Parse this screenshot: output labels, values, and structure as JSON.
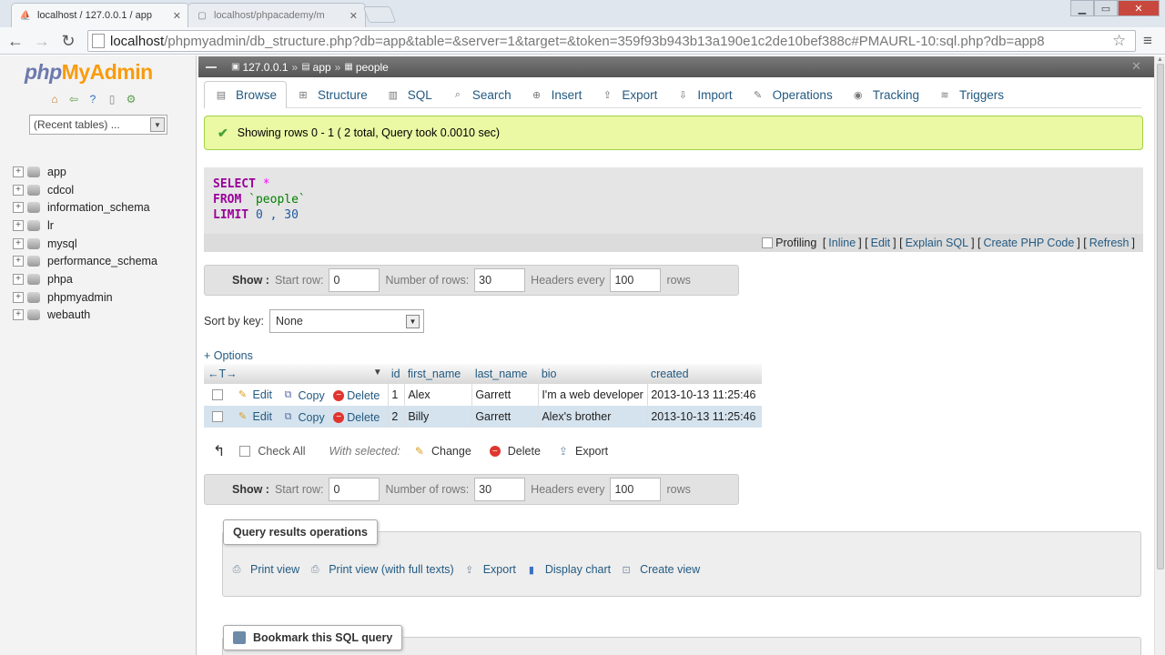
{
  "browser": {
    "tabs": [
      {
        "title": "localhost / 127.0.0.1 / app"
      },
      {
        "title": "localhost/phpacademy/m"
      }
    ],
    "address": {
      "host": "localhost",
      "path": "/phpmyadmin/db_structure.php?db=app&table=&server=1&target=&token=359f93b943b13a190e1c2de10bef388c#PMAURL-10:sql.php?db=app8"
    }
  },
  "sidebar": {
    "logo": {
      "php": "php",
      "my": "My",
      "admin": "Admin"
    },
    "recent_tables": "(Recent tables) ...",
    "databases": [
      "app",
      "cdcol",
      "information_schema",
      "lr",
      "mysql",
      "performance_schema",
      "phpa",
      "phpmyadmin",
      "webauth"
    ]
  },
  "breadcrumb": {
    "server": "127.0.0.1",
    "database": "app",
    "table": "people",
    "sep": "»"
  },
  "tabs": [
    {
      "label": "Browse",
      "icon": "browse-icon"
    },
    {
      "label": "Structure",
      "icon": "structure-icon"
    },
    {
      "label": "SQL",
      "icon": "sql-icon"
    },
    {
      "label": "Search",
      "icon": "search-icon"
    },
    {
      "label": "Insert",
      "icon": "insert-icon"
    },
    {
      "label": "Export",
      "icon": "export-icon"
    },
    {
      "label": "Import",
      "icon": "import-icon"
    },
    {
      "label": "Operations",
      "icon": "wrench-icon"
    },
    {
      "label": "Tracking",
      "icon": "eye-icon"
    },
    {
      "label": "Triggers",
      "icon": "triggers-icon"
    }
  ],
  "message": "Showing rows 0 - 1 ( 2 total, Query took 0.0010 sec)",
  "sql": {
    "select_kw": "SELECT",
    "star": "*",
    "from_kw": "FROM",
    "table": "`people`",
    "limit_kw": "LIMIT",
    "limit_args": "0 , 30"
  },
  "sql_actions": {
    "profiling": "Profiling",
    "links": [
      "Inline",
      "Edit",
      "Explain SQL",
      "Create PHP Code",
      "Refresh"
    ]
  },
  "show": {
    "label": "Show :",
    "start_row_label": "Start row:",
    "start_row": "0",
    "num_rows_label": "Number of rows:",
    "num_rows": "30",
    "headers_label": "Headers every",
    "headers_every": "100",
    "rows_label": "rows"
  },
  "sort_key": {
    "label": "Sort by key:",
    "value": "None"
  },
  "options_link": "+ Options",
  "table": {
    "arrows": "←T→",
    "columns": [
      "id",
      "first_name",
      "last_name",
      "bio",
      "created"
    ],
    "actions": {
      "edit": "Edit",
      "copy": "Copy",
      "delete": "Delete"
    },
    "rows": [
      {
        "id": "1",
        "first_name": "Alex",
        "last_name": "Garrett",
        "bio": "I'm a web developer",
        "created": "2013-10-13 11:25:46"
      },
      {
        "id": "2",
        "first_name": "Billy",
        "last_name": "Garrett",
        "bio": "Alex's brother",
        "created": "2013-10-13 11:25:46"
      }
    ]
  },
  "with_selected": {
    "check_all": "Check All",
    "label": "With selected:",
    "change": "Change",
    "delete": "Delete",
    "export": "Export"
  },
  "query_ops": {
    "legend": "Query results operations",
    "items": [
      "Print view",
      "Print view (with full texts)",
      "Export",
      "Display chart",
      "Create view"
    ]
  },
  "bookmark": {
    "legend": "Bookmark this SQL query"
  }
}
